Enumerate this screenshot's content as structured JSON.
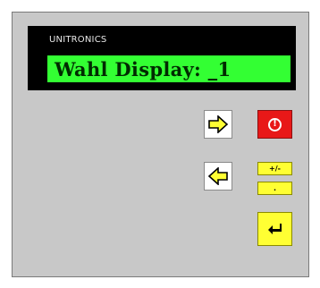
{
  "brand": "UNITRONICS",
  "display": {
    "text": "Wahl Display: _1"
  },
  "keys": {
    "plus_minus": "+/-",
    "dot": "."
  },
  "colors": {
    "lcd_background": "#33ff33",
    "escape_key": "#e81818",
    "yellow_keys": "#ffff33",
    "arrow_fill": "#ffff33"
  },
  "icons": {
    "right": "arrow-right-icon",
    "left": "arrow-left-icon",
    "escape": "exclamation-icon",
    "enter": "enter-icon"
  }
}
